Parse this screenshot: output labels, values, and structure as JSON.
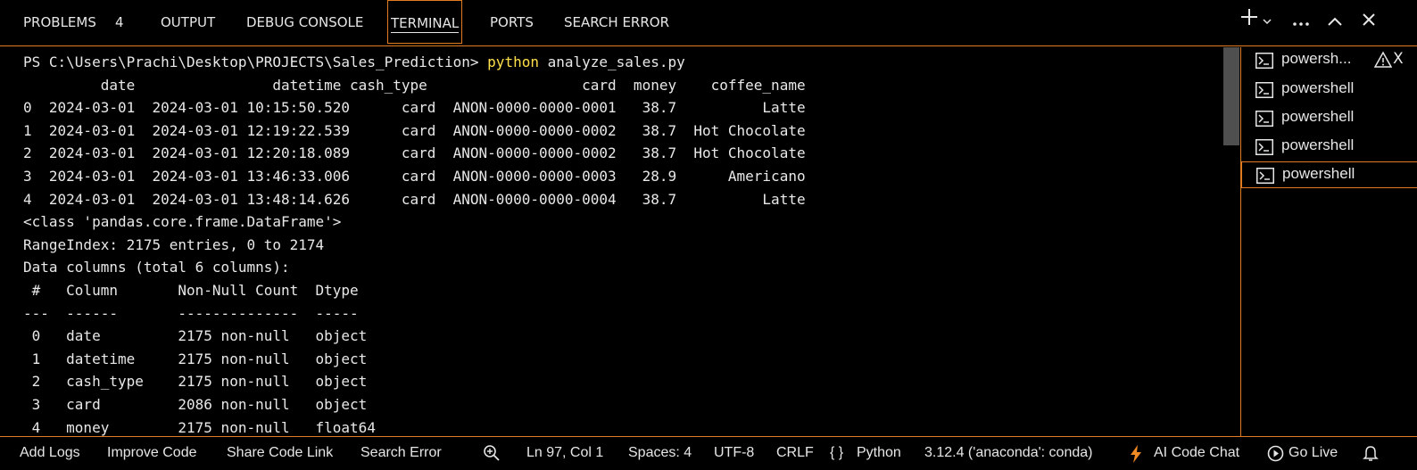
{
  "tabs": {
    "problems": "PROBLEMS",
    "problems_count": "4",
    "output": "OUTPUT",
    "debug_console": "DEBUG CONSOLE",
    "terminal": "TERMINAL",
    "ports": "PORTS",
    "search_error": "SEARCH ERROR",
    "active": "TERMINAL"
  },
  "toolbar_icons": [
    "plus-icon",
    "chevron-down-icon",
    "ellipsis-icon",
    "chevron-up-icon",
    "close-icon"
  ],
  "terminal": {
    "prompt": "PS C:\\Users\\Prachi\\Desktop\\PROJECTS\\Sales_Prediction> ",
    "command": "python",
    "command_args": " analyze_sales.py",
    "lines": [
      "         date                datetime cash_type                  card  money    coffee_name",
      "0  2024-03-01  2024-03-01 10:15:50.520      card  ANON-0000-0000-0001   38.7          Latte",
      "1  2024-03-01  2024-03-01 12:19:22.539      card  ANON-0000-0000-0002   38.7  Hot Chocolate",
      "2  2024-03-01  2024-03-01 12:20:18.089      card  ANON-0000-0000-0002   38.7  Hot Chocolate",
      "3  2024-03-01  2024-03-01 13:46:33.006      card  ANON-0000-0000-0003   28.9      Americano",
      "4  2024-03-01  2024-03-01 13:48:14.626      card  ANON-0000-0000-0004   38.7          Latte",
      "<class 'pandas.core.frame.DataFrame'>",
      "RangeIndex: 2175 entries, 0 to 2174",
      "Data columns (total 6 columns):",
      " #   Column       Non-Null Count  Dtype",
      "---  ------       --------------  -----",
      " 0   date         2175 non-null   object",
      " 1   datetime     2175 non-null   object",
      " 2   cash_type    2175 non-null   object",
      " 3   card         2086 non-null   object",
      " 4   money        2175 non-null   float64"
    ]
  },
  "terminal_list": [
    {
      "label": "powersh...",
      "warning": true,
      "close": "X"
    },
    {
      "label": "powershell"
    },
    {
      "label": "powershell"
    },
    {
      "label": "powershell"
    },
    {
      "label": "powershell",
      "selected": true
    }
  ],
  "statusbar": {
    "add_logs": "Add Logs",
    "improve_code": "Improve Code",
    "share_code_link": "Share Code Link",
    "search_error": "Search Error",
    "cursor_position": "Ln 97, Col 1",
    "spaces": "Spaces: 4",
    "encoding": "UTF-8",
    "line_ending": "CRLF",
    "language_icon": "{ }",
    "language": "Python",
    "interpreter": "3.12.4 ('anaconda': conda)",
    "ai_chat": "AI Code Chat",
    "go_live": "Go Live"
  },
  "colors": {
    "accent": "#e07b1f",
    "command": "#ffe04a",
    "background": "#000000",
    "text": "#e8e8e8"
  }
}
